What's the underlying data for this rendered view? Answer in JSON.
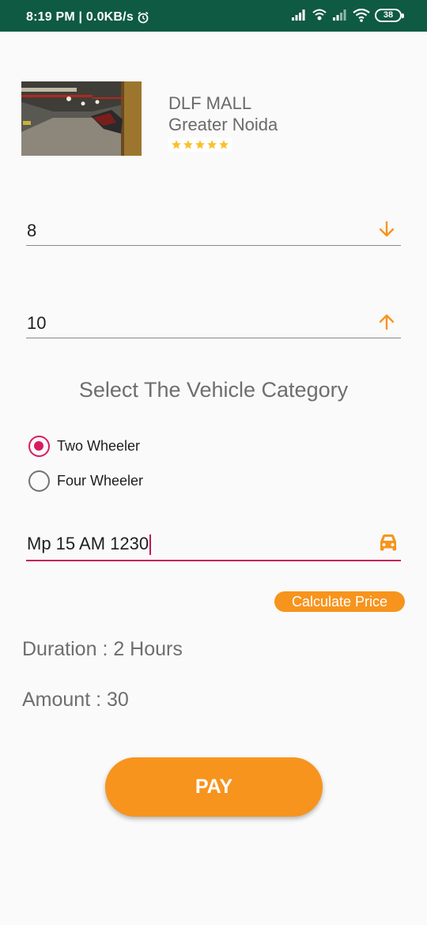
{
  "status_bar": {
    "time_speed": "8:19 PM | 0.0KB/s",
    "battery": "38"
  },
  "mall": {
    "name": "DLF MALL",
    "city": "Greater Noida",
    "rating": 5
  },
  "from_field": {
    "value": "8",
    "icon": "arrow-down-icon"
  },
  "to_field": {
    "value": "10",
    "icon": "arrow-up-icon"
  },
  "vehicle_category": {
    "title": "Select The Vehicle Category",
    "options": [
      {
        "label": "Two Wheeler",
        "selected": true
      },
      {
        "label": "Four Wheeler",
        "selected": false
      }
    ]
  },
  "vehicle_number": {
    "value": "Mp 15 AM 1230",
    "icon": "car-icon"
  },
  "calculate_label": "Calculate Price",
  "result": {
    "duration": "Duration : 2 Hours",
    "amount": "Amount : 30"
  },
  "pay_label": "PAY",
  "colors": {
    "status_bar": "#0f5a43",
    "accent_orange": "#f7941d",
    "accent_pink": "#d81b60",
    "star_yellow": "#fbc02d"
  }
}
